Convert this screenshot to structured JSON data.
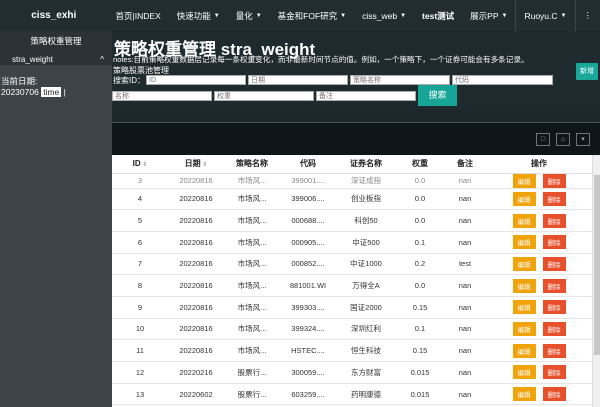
{
  "brand": "ciss_exhi",
  "nav": {
    "items": [
      {
        "label": "首页|INDEX",
        "caret": false,
        "bold": false
      },
      {
        "label": "快速功能",
        "caret": true,
        "bold": false
      },
      {
        "label": "量化",
        "caret": true,
        "bold": false
      },
      {
        "label": "基金和FOF研究",
        "caret": true,
        "bold": false
      },
      {
        "label": "ciss_web",
        "caret": true,
        "bold": false
      },
      {
        "label": "test测试",
        "caret": false,
        "bold": true
      },
      {
        "label": "展示PP",
        "caret": true,
        "bold": false
      }
    ],
    "user": "Ruoyu.C",
    "more": "⋮"
  },
  "sidebar": {
    "title": "策略权重管理",
    "item": "stra_weight",
    "item_caret": "^",
    "date_label": "当前日期:",
    "date_value": "20230706",
    "time_chip": "time",
    "cursor": "|"
  },
  "header": {
    "title": "策略权重管理 stra_weight",
    "notes": "notes:目前策略权重数据层记录每一条权重变化，而非最新时间节点的值。例如，一个策略下，一个证券可能会有多条记录。",
    "subtitle": "策略股票池管理",
    "add_button": "新增",
    "search_label": "搜索ID：",
    "search_button": "搜索",
    "inputs": {
      "id": "ID",
      "date": "日期",
      "strategy": "策略名称",
      "code": "代码",
      "name": "名称",
      "weight": "权重",
      "remark": "备注"
    }
  },
  "toolbar": {
    "btn1": "□",
    "btn2": "⌂",
    "btn3": "▾"
  },
  "table": {
    "headers": [
      "ID",
      "日期",
      "策略名称",
      "代码",
      "证券名称",
      "权重",
      "备注",
      "操作"
    ],
    "edit_label": "编辑",
    "delete_label": "删除",
    "rows": [
      [
        "3",
        "20220816",
        "市场风...",
        "399001....",
        "深证成指",
        "0.0",
        "nan"
      ],
      [
        "4",
        "20220816",
        "市场风...",
        "399006....",
        "创业板指",
        "0.0",
        "nan"
      ],
      [
        "5",
        "20220816",
        "市场风...",
        "000688....",
        "科创50",
        "0.0",
        "nan"
      ],
      [
        "6",
        "20220816",
        "市场风...",
        "000905....",
        "中证500",
        "0.1",
        "nan"
      ],
      [
        "7",
        "20220816",
        "市场风...",
        "000852....",
        "中证1000",
        "0.2",
        "test"
      ],
      [
        "8",
        "20220816",
        "市场风...",
        "881001.WI",
        "万得全A",
        "0.0",
        "nan"
      ],
      [
        "9",
        "20220816",
        "市场风...",
        "399303....",
        "国证2000",
        "0.15",
        "nan"
      ],
      [
        "10",
        "20220816",
        "市场风...",
        "399324....",
        "深圳红利",
        "0.1",
        "nan"
      ],
      [
        "11",
        "20220816",
        "市场风...",
        "HSTEC....",
        "恒生科技",
        "0.15",
        "nan"
      ],
      [
        "12",
        "20220216",
        "股票行...",
        "300059....",
        "东方财富",
        "0.015",
        "nan"
      ],
      [
        "13",
        "20220602",
        "股票行...",
        "603259....",
        "药明康德",
        "0.015",
        "nan"
      ]
    ]
  }
}
